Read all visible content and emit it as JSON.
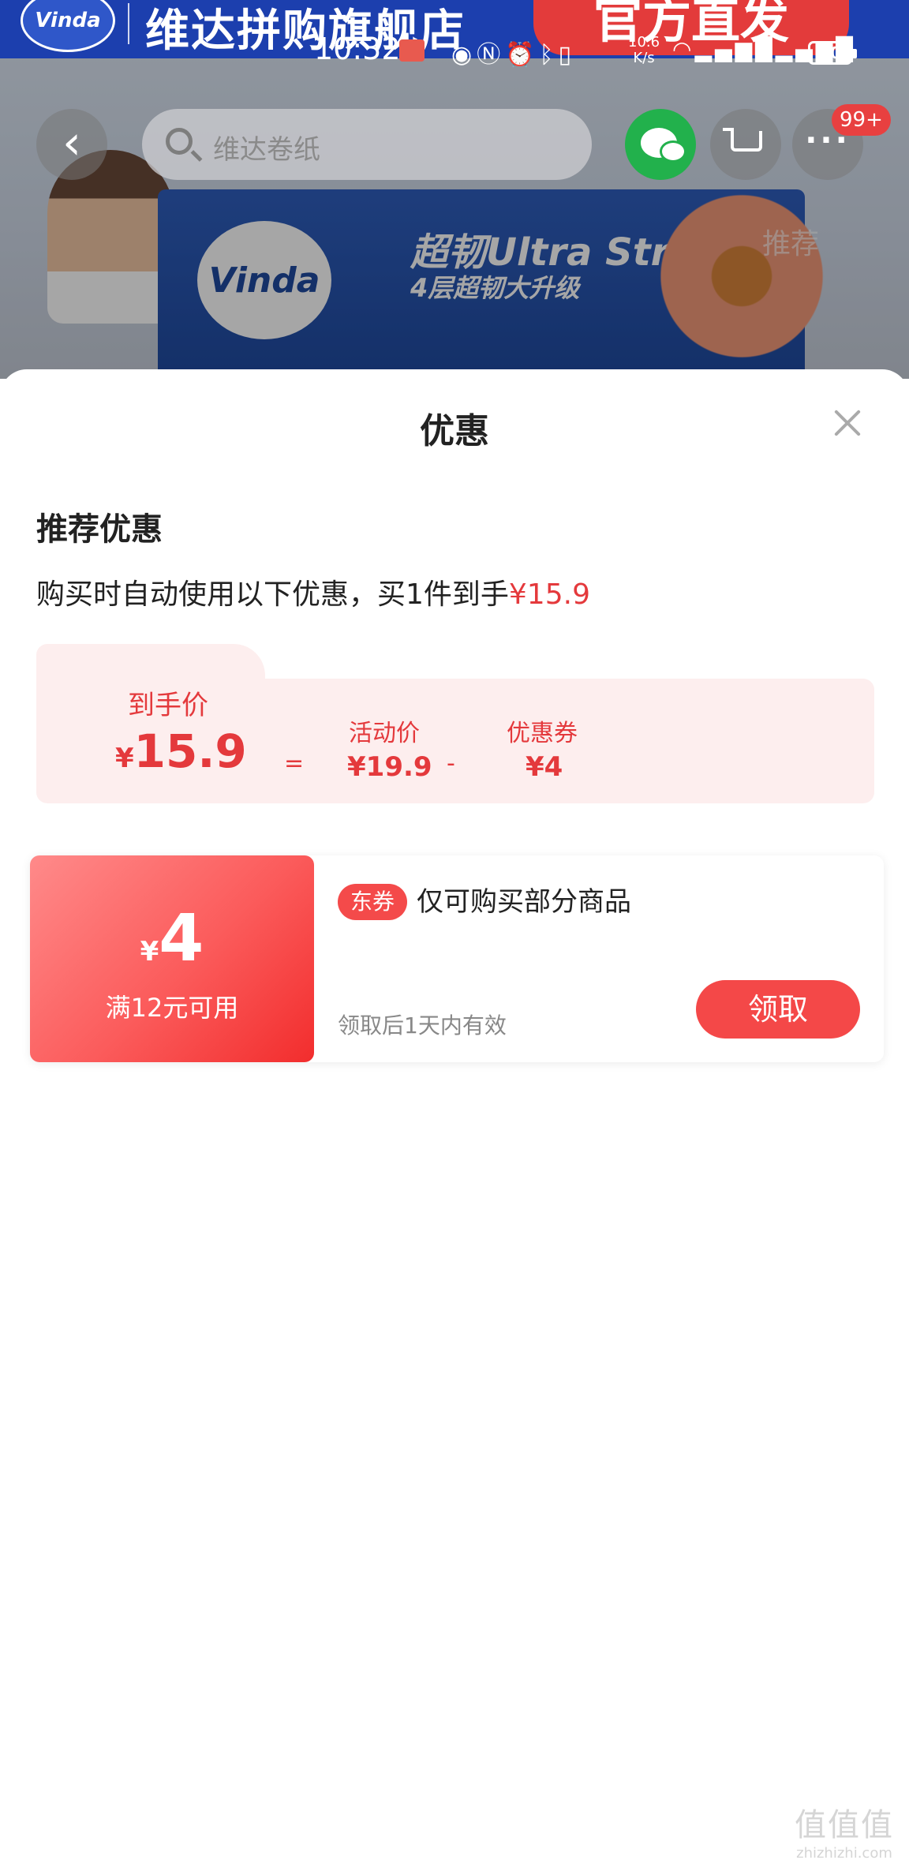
{
  "status_bar": {
    "time": "10:32",
    "net_speed_value": "10.6",
    "net_speed_unit": "K/s",
    "battery": "70",
    "icons": [
      "eye-icon",
      "nfc-icon",
      "alarm-icon",
      "bluetooth-icon",
      "vibrate-icon",
      "wifi-icon",
      "signal-4g-icon",
      "signal-4g-icon"
    ]
  },
  "background": {
    "store_name": "维达拼购旗舰店",
    "store_logo": "Vinda",
    "store_tag": "官方直发",
    "hero_logo": "Vinda",
    "hero_title": "超韧Ultra Strong",
    "hero_subtitle": "4层超韧大升级",
    "search_placeholder": "维达卷纸",
    "message_badge": "99+",
    "recommend_tab": "推荐"
  },
  "sheet": {
    "title": "优惠",
    "section_title": "推荐优惠",
    "summary_text": "购买时自动使用以下优惠，买1件到手",
    "summary_price": "¥15.9",
    "calc": {
      "final_label": "到手价",
      "final_currency": "¥",
      "final_value": "15.9",
      "eq": "=",
      "activity_label": "活动价",
      "activity_price": "¥19.9",
      "minus": "-",
      "coupon_label": "优惠券",
      "coupon_price": "¥4"
    },
    "coupon": {
      "currency": "¥",
      "value": "4",
      "condition": "满12元可用",
      "tag": "东券",
      "description": "仅可购买部分商品",
      "validity": "领取后1天内有效",
      "button": "领取"
    }
  },
  "watermark": {
    "logo": "值值值",
    "text": "zhizhizhi.com"
  },
  "colors": {
    "accent_red": "#e4393c",
    "button_red": "#f44848",
    "calc_bg": "#fdeeee"
  }
}
